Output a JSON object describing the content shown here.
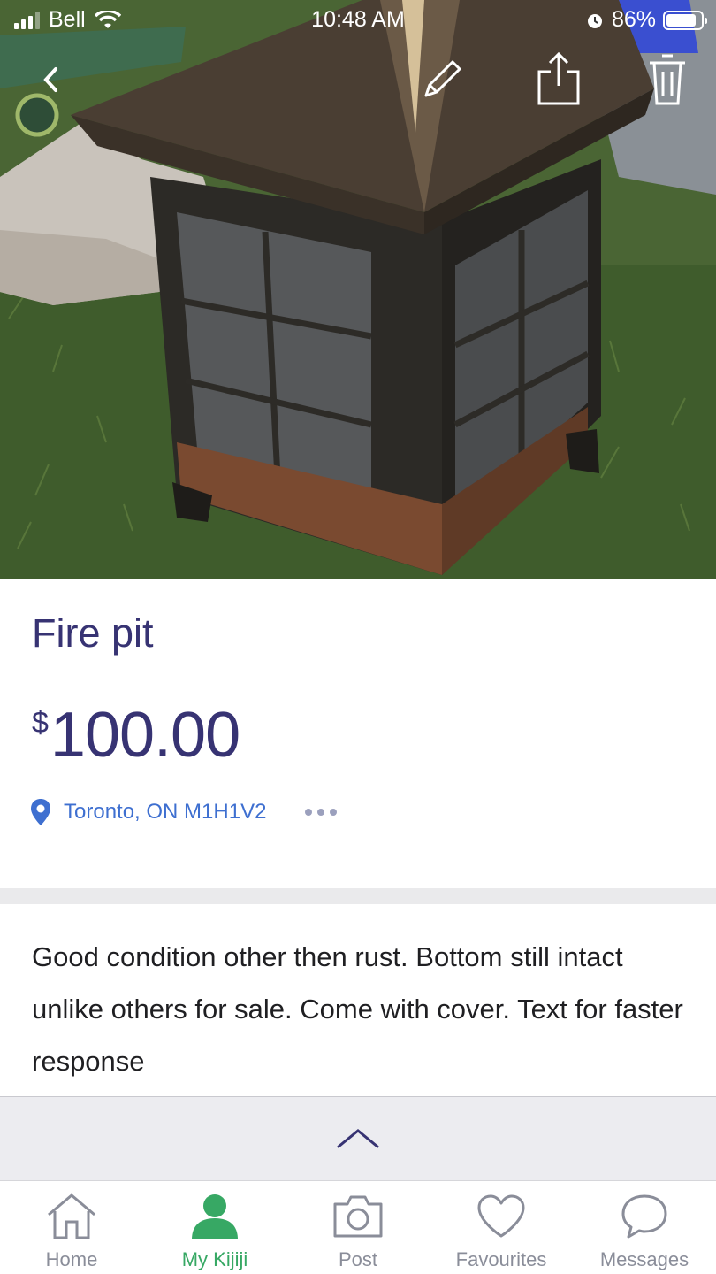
{
  "status_bar": {
    "carrier": "Bell",
    "time": "10:48 AM",
    "battery": "86%",
    "battery_level": 0.86
  },
  "listing": {
    "title": "Fire pit",
    "currency_symbol": "$",
    "price": "100.00",
    "location": "Toronto, ON M1H1V2",
    "description": "Good condition other then rust. Bottom still intact unlike others for sale. Come with cover. Text for faster response"
  },
  "tabs": [
    {
      "label": "Home",
      "icon": "home-icon",
      "active": false
    },
    {
      "label": "My Kijiji",
      "icon": "user-icon",
      "active": true
    },
    {
      "label": "Post",
      "icon": "camera-icon",
      "active": false
    },
    {
      "label": "Favourites",
      "icon": "heart-icon",
      "active": false
    },
    {
      "label": "Messages",
      "icon": "chat-bubble-icon",
      "active": false
    }
  ],
  "colors": {
    "brand_navy": "#373373",
    "link_blue": "#3e6fd0",
    "active_green": "#37a864",
    "inactive_gray": "#8a8d99"
  }
}
